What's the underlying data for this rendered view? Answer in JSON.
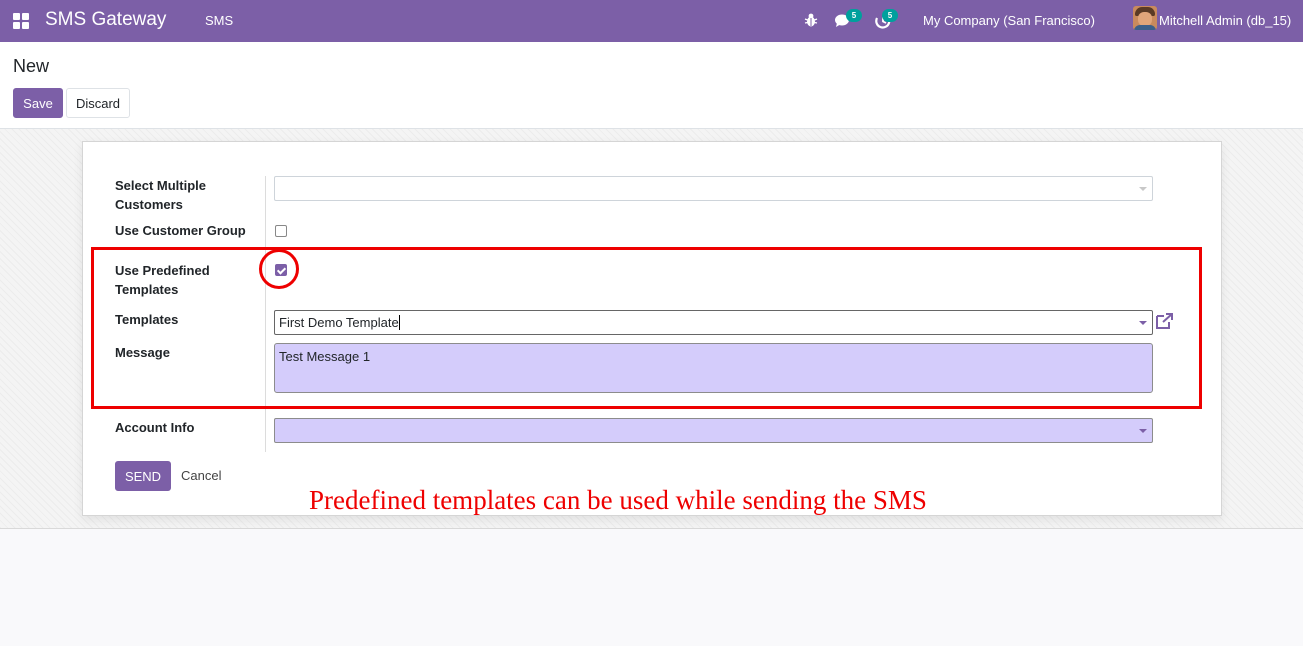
{
  "navbar": {
    "app_title": "SMS Gateway",
    "menu_item": "SMS",
    "icons": [
      "apps-grid-icon",
      "bug-icon",
      "chat-icon",
      "activity-clock-icon"
    ],
    "messages_count": "5",
    "activities_count": "5",
    "company": "My Company (San Francisco)",
    "user": "Mitchell Admin (db_15)"
  },
  "control_panel": {
    "breadcrumb": "New",
    "save_label": "Save",
    "discard_label": "Discard"
  },
  "form": {
    "select_customers_label": "Select Multiple Customers",
    "select_customers_value": "",
    "customer_group_label": "Use Customer Group",
    "customer_group_checked": false,
    "predefined_label": "Use Predefined Templates",
    "predefined_checked": true,
    "templates_label": "Templates",
    "templates_value": "First Demo Template",
    "message_label": "Message",
    "message_value": "Test Message 1",
    "account_label": "Account Info",
    "account_value": "",
    "send_label": "SEND",
    "cancel_label": "Cancel"
  },
  "annotation": {
    "caption": "Predefined templates can be used while sending the SMS",
    "color": "#ee0000"
  },
  "theme": {
    "primary": "#7c5fa7",
    "badge": "#00a09d",
    "field_highlight": "#d4ccfb"
  }
}
